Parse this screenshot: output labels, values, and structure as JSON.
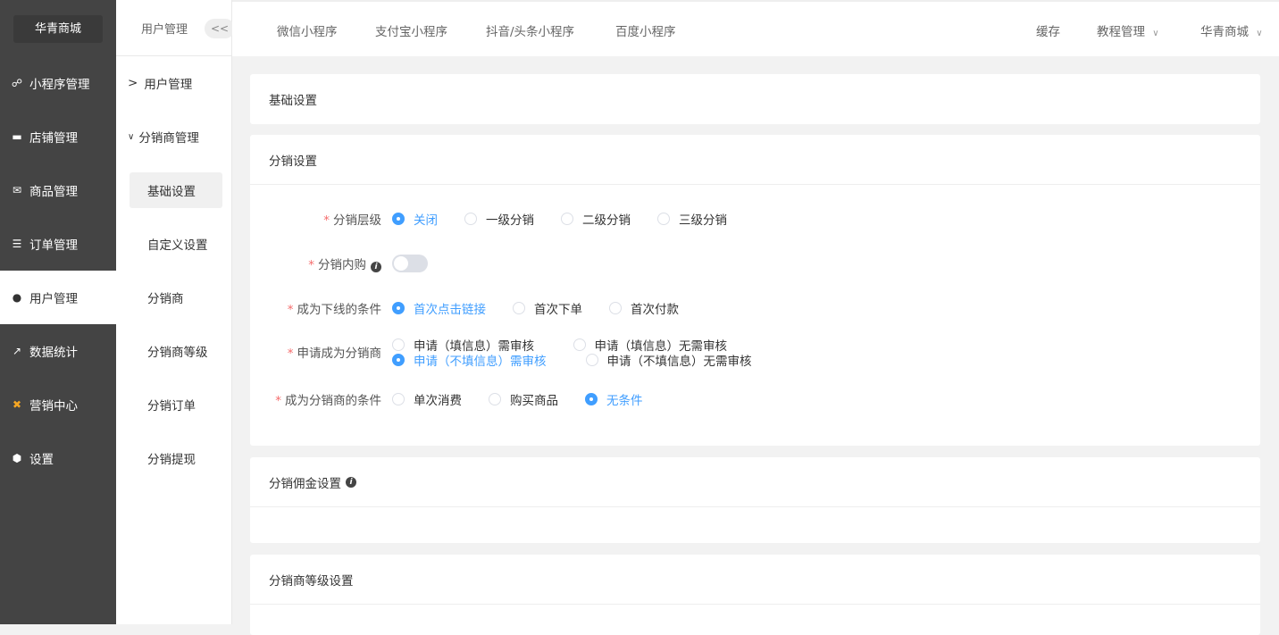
{
  "brand": "华青商城",
  "sidebar": {
    "items": [
      {
        "label": "小程序管理",
        "icon": "link-icon"
      },
      {
        "label": "店铺管理",
        "icon": "shop-icon"
      },
      {
        "label": "商品管理",
        "icon": "goods-icon"
      },
      {
        "label": "订单管理",
        "icon": "order-icon"
      },
      {
        "label": "用户管理",
        "icon": "user-icon"
      },
      {
        "label": "数据统计",
        "icon": "chart-icon"
      },
      {
        "label": "营销中心",
        "icon": "marketing-icon"
      },
      {
        "label": "设置",
        "icon": "gear-icon"
      }
    ]
  },
  "subnav": {
    "title": "用户管理",
    "collapse": "<<",
    "groups": [
      {
        "label": "用户管理",
        "arrow": ">"
      },
      {
        "label": "分销商管理",
        "arrow": "∨"
      }
    ],
    "items": [
      "基础设置",
      "自定义设置",
      "分销商",
      "分销商等级",
      "分销订单",
      "分销提现"
    ]
  },
  "topbar": {
    "tabs": [
      "微信小程序",
      "支付宝小程序",
      "抖音/头条小程序",
      "百度小程序"
    ],
    "right": [
      "缓存",
      "教程管理",
      "华青商城"
    ]
  },
  "cards": {
    "basic": "基础设置",
    "distribution": "分销设置",
    "commission": "分销佣金设置",
    "level": "分销商等级设置"
  },
  "form": {
    "level": {
      "label": "分销层级",
      "options": [
        "关闭",
        "一级分销",
        "二级分销",
        "三级分销"
      ],
      "selected": 0
    },
    "internal": {
      "label": "分销内购",
      "enabled": false
    },
    "downline": {
      "label": "成为下线的条件",
      "options": [
        "首次点击链接",
        "首次下单",
        "首次付款"
      ],
      "selected": 0
    },
    "apply": {
      "label": "申请成为分销商",
      "options": [
        "申请（填信息）需审核",
        "申请（填信息）无需审核",
        "申请（不填信息）需审核",
        "申请（不填信息）无需审核"
      ],
      "selected": 2
    },
    "condition": {
      "label": "成为分销商的条件",
      "options": [
        "单次消费",
        "购买商品",
        "无条件"
      ],
      "selected": 2
    }
  }
}
